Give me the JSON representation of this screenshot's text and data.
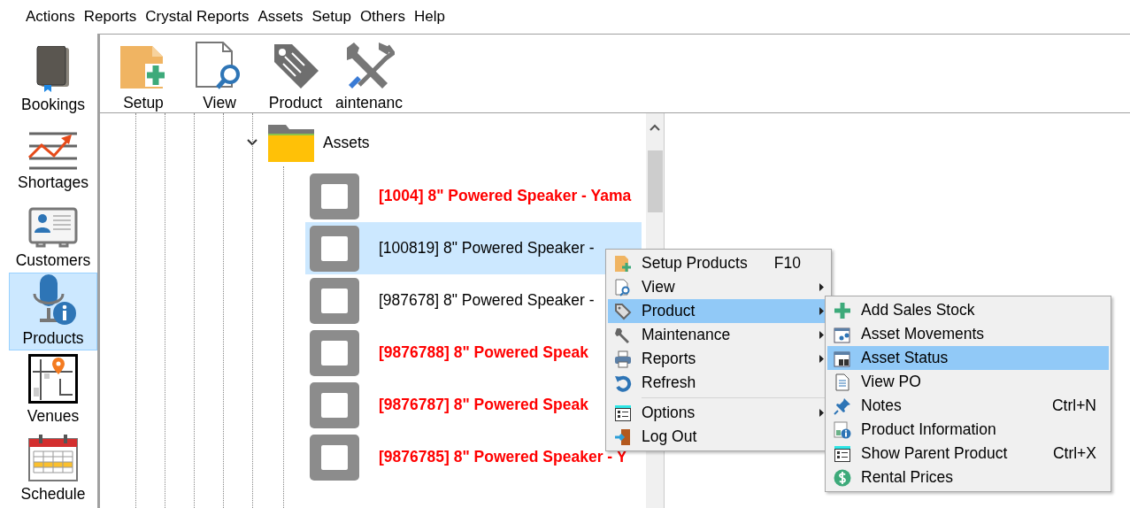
{
  "menu_bar": [
    "Actions",
    "Reports",
    "Crystal Reports",
    "Assets",
    "Setup",
    "Others",
    "Help"
  ],
  "sidebar": {
    "items": [
      {
        "label": "Bookings",
        "selected": false
      },
      {
        "label": "Shortages",
        "selected": false
      },
      {
        "label": "Customers",
        "selected": false
      },
      {
        "label": "Products",
        "selected": true
      },
      {
        "label": "Venues",
        "selected": false
      },
      {
        "label": "Schedule",
        "selected": false
      }
    ]
  },
  "toolbar": [
    "Setup",
    "View",
    "Product",
    "aintenanc"
  ],
  "tree": {
    "folder": {
      "label": "Assets",
      "expanded": true
    },
    "rows": [
      {
        "label": "[1004] 8\" Powered Speaker - Yama",
        "kind": "alert",
        "selected": false
      },
      {
        "label": "[100819] 8\" Powered Speaker -",
        "kind": "normal",
        "selected": true
      },
      {
        "label": "[987678] 8\" Powered Speaker -",
        "kind": "normal",
        "selected": false
      },
      {
        "label": "[9876788] 8\" Powered Speak",
        "kind": "alert",
        "selected": false
      },
      {
        "label": "[9876787] 8\" Powered Speak",
        "kind": "alert",
        "selected": false
      },
      {
        "label": "[9876785] 8\" Powered Speaker - Y",
        "kind": "alert",
        "selected": false
      }
    ]
  },
  "context_menu": {
    "items": [
      {
        "label": "Setup Products",
        "shortcut": "F10",
        "submenu": false,
        "selected": false,
        "separator_before": false
      },
      {
        "label": "View",
        "submenu": true,
        "selected": false,
        "separator_before": false
      },
      {
        "label": "Product",
        "submenu": true,
        "selected": true,
        "separator_before": false
      },
      {
        "label": "Maintenance",
        "submenu": true,
        "selected": false,
        "separator_before": false
      },
      {
        "label": "Reports",
        "submenu": true,
        "selected": false,
        "separator_before": false
      },
      {
        "label": "Refresh",
        "submenu": false,
        "selected": false,
        "separator_before": false
      },
      {
        "label": "Options",
        "submenu": true,
        "selected": false,
        "separator_before": true
      },
      {
        "label": "Log Out",
        "submenu": false,
        "selected": false,
        "separator_before": false
      }
    ]
  },
  "submenu": {
    "items": [
      {
        "label": "Add Sales Stock",
        "selected": false
      },
      {
        "label": "Asset Movements",
        "selected": false
      },
      {
        "label": "Asset Status",
        "selected": true
      },
      {
        "label": "View PO",
        "selected": false
      },
      {
        "label": "Notes",
        "shortcut": "Ctrl+N",
        "selected": false
      },
      {
        "label": "Product Information",
        "selected": false
      },
      {
        "label": "Show Parent Product",
        "shortcut": "Ctrl+X",
        "selected": false
      },
      {
        "label": "Rental Prices",
        "selected": false
      }
    ]
  }
}
